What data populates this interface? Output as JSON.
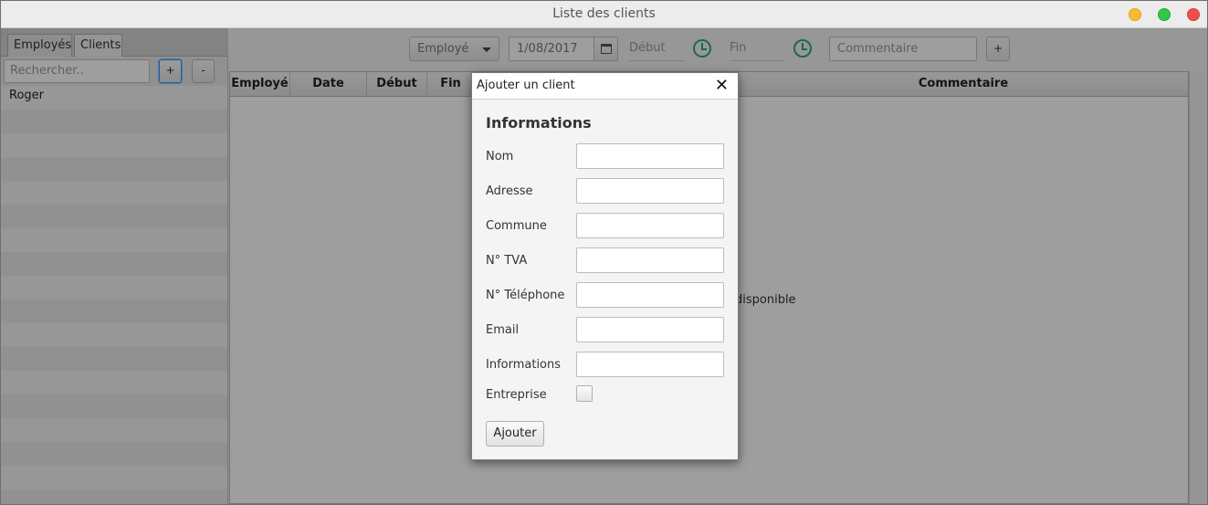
{
  "window": {
    "title": "Liste des clients"
  },
  "left": {
    "tabs": [
      {
        "label": "Employés"
      },
      {
        "label": "Clients"
      }
    ],
    "search_placeholder": "Rechercher..",
    "add_label": "+",
    "remove_label": "-",
    "items": [
      {
        "label": "Roger"
      }
    ]
  },
  "toolbar": {
    "employee_combo": "Employé",
    "date_value": "1/08/2017",
    "start_placeholder": "Début",
    "end_placeholder": "Fin",
    "comment_placeholder": "Commentaire",
    "add_label": "+"
  },
  "table": {
    "columns": [
      "Employé",
      "Date",
      "Début",
      "Fin",
      "Commentaire"
    ],
    "empty_text": "disponible"
  },
  "dialog": {
    "title": "Ajouter un client",
    "close_glyph": "✕",
    "section": "Informations",
    "fields": [
      {
        "label": "Nom",
        "value": ""
      },
      {
        "label": "Adresse",
        "value": ""
      },
      {
        "label": "Commune",
        "value": ""
      },
      {
        "label": "N° TVA",
        "value": ""
      },
      {
        "label": "N° Téléphone",
        "value": ""
      },
      {
        "label": "Email",
        "value": ""
      },
      {
        "label": "Informations",
        "value": ""
      }
    ],
    "checkbox_label": "Entreprise",
    "checkbox_checked": false,
    "submit_label": "Ajouter"
  },
  "colors": {
    "traffic_min": "#f5bd2f",
    "traffic_max": "#33c748",
    "traffic_close": "#ef4f4c",
    "clock_accent": "#2aa88f",
    "focus_blue": "#3b99fc"
  }
}
